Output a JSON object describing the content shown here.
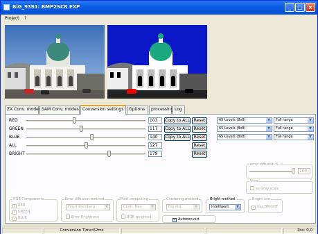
{
  "window": {
    "title": "BiG_9391: BMP2SCR EXP"
  },
  "menu": [
    "Project",
    "?"
  ],
  "tabs": [
    {
      "label": "ZX Conv. modes",
      "active": false
    },
    {
      "label": "SAM Conv. modes",
      "active": false
    },
    {
      "label": "Conversion settings",
      "active": true
    },
    {
      "label": "Options",
      "active": false
    },
    {
      "label": "processing",
      "active": false
    },
    {
      "label": "Log",
      "active": false
    }
  ],
  "sliders": [
    {
      "label": "RED",
      "value": "103",
      "level": 0.4,
      "copy_label": "Copy to ALL",
      "reset_label": "Reset"
    },
    {
      "label": "GREEN",
      "value": "117",
      "level": 0.46,
      "copy_label": "Copy to ALL",
      "reset_label": "Reset"
    },
    {
      "label": "BLUE",
      "value": "140",
      "level": 0.55,
      "copy_label": "Copy to ALL",
      "reset_label": "Reset"
    },
    {
      "label": "ALL",
      "value": "127",
      "level": 0.5,
      "copy_label": "",
      "reset_label": "Reset"
    },
    {
      "label": "BRIGHT",
      "value": "179",
      "level": 0.7,
      "copy_label": "",
      "reset_label": "Reset"
    }
  ],
  "level_combos": [
    {
      "levels": "65 Levels (8x8)",
      "range": "Full range"
    },
    {
      "levels": "65 Levels (8x8)",
      "range": "Full range"
    },
    {
      "levels": "65 Levels (8x8)",
      "range": "Full range"
    }
  ],
  "error_diffusion": {
    "title": "error diffusion %",
    "value": "100"
  },
  "view": {
    "title": "View",
    "checkbox": "as Grey scale"
  },
  "rgb_components": {
    "title": "RGB Components",
    "items": [
      "RED",
      "GREEN",
      "BLUE"
    ]
  },
  "error_diffusion_method": {
    "title": "Error diffusion method",
    "value": "Floyd Steinberg",
    "checkbox": "Error Brightness"
  },
  "pixel_computing": {
    "title": "Pixel computing",
    "value": "Contr. Max",
    "checkbox": "RGB weighted"
  },
  "clustering": {
    "title": "Clustering method",
    "value": "Big dist."
  },
  "bright_method": {
    "title": "Bright method",
    "value": "Intelligent"
  },
  "bright_use": {
    "title": "Bright use",
    "checkbox": "Use BRIGHT"
  },
  "autoconvert": {
    "label": "Autoconvert",
    "checked": "✓"
  },
  "status": {
    "conversion_time": "Conversion Time:62ms",
    "pos": "Pos: 0,0"
  },
  "colors": {
    "titlebar": "#0a5ee6",
    "active_tab_accent": "#f0a22a",
    "panel_bg": "#fcfcfe"
  }
}
